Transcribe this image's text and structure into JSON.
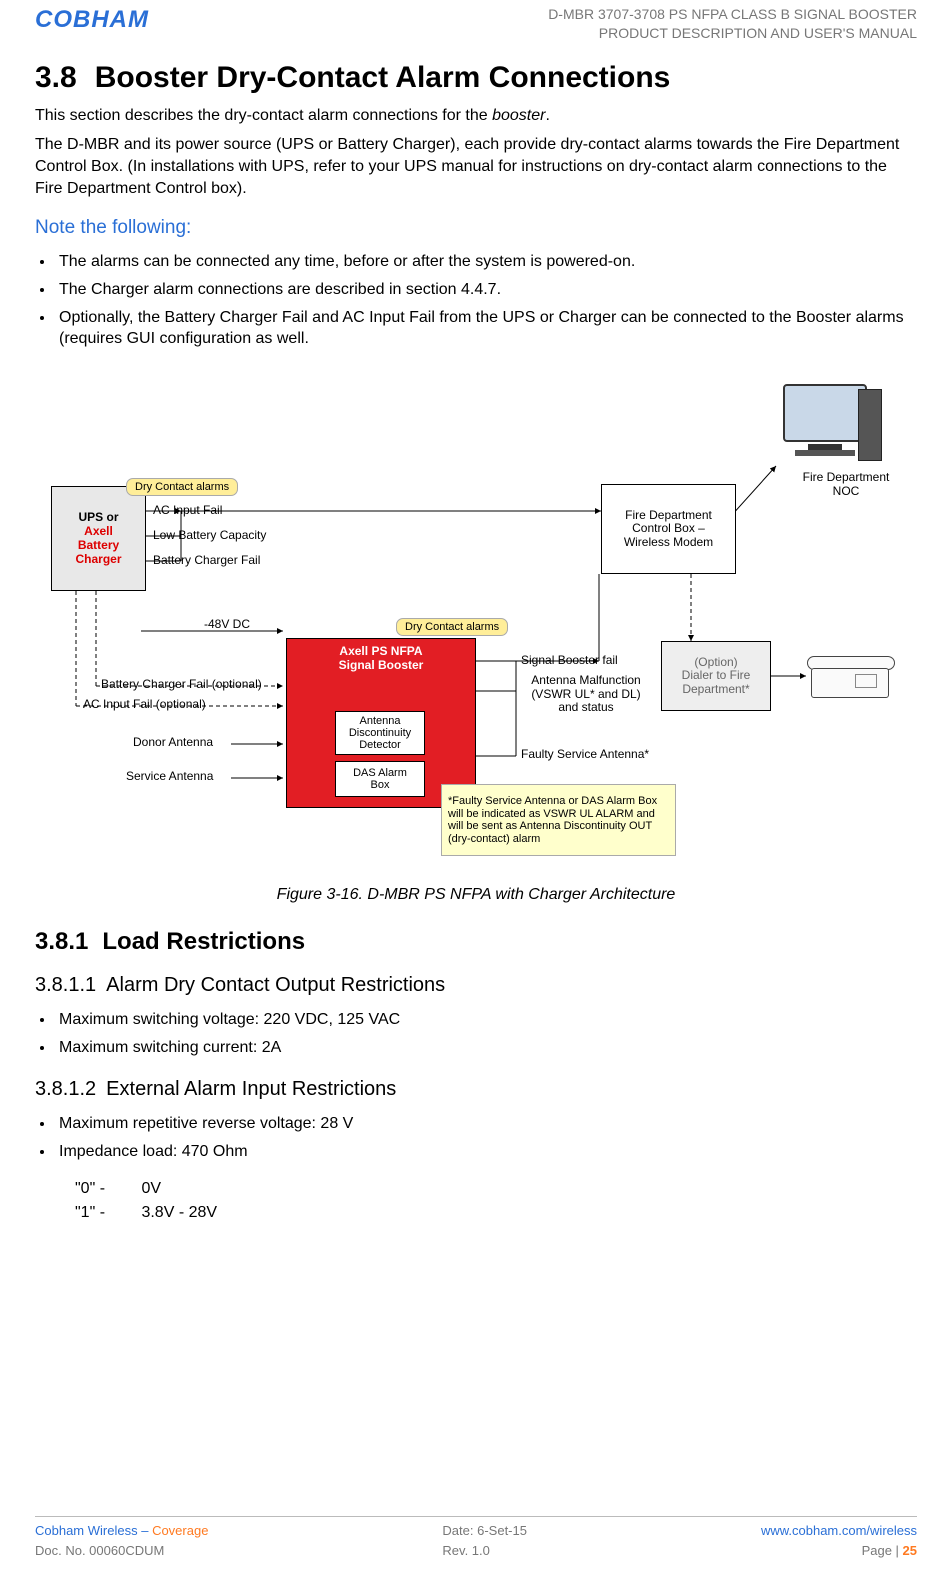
{
  "header": {
    "logo_text": "COBHAM",
    "line1": "D-MBR 3707-3708 PS NFPA CLASS B SIGNAL BOOSTER",
    "line2": "PRODUCT DESCRIPTION AND USER'S MANUAL"
  },
  "section": {
    "number": "3.8",
    "title": "Booster Dry-Contact Alarm Connections",
    "intro1_a": "This section describes the dry-contact alarm connections for the ",
    "intro1_em": "booster",
    "intro1_b": ".",
    "intro2": "The D-MBR and its power source (UPS or Battery Charger), each provide dry-contact alarms towards the Fire Department Control Box. (In installations with UPS, refer to your UPS manual for instructions on dry-contact alarm connections to the Fire Department Control box).",
    "note_title": "Note the following:",
    "bullets": [
      "The alarms can be connected any time, before or after the system is powered-on.",
      "The Charger alarm connections are described in section 4.4.7.",
      "Optionally, the Battery Charger Fail and AC Input Fail from the UPS or Charger can be connected to the Booster alarms (requires GUI configuration as well."
    ]
  },
  "figure": {
    "caption": "Figure 3-16. D-MBR PS NFPA with Charger Architecture",
    "yellow_labels": {
      "dca1": "Dry Contact alarms",
      "dca2": "Dry Contact alarms"
    },
    "ups_box_line1": "UPS or",
    "ups_box_line2": "Axell",
    "ups_box_line3": "Battery Charger",
    "ups_alarms": {
      "a1": "AC Input Fail",
      "a2": "Low Battery Capacity",
      "a3": "Battery Charger Fail"
    },
    "dashed": {
      "d1": "Battery Charger Fail (optional)",
      "d2": "AC Input Fail (optional)"
    },
    "dc_label": "-48V DC",
    "antennas": {
      "donor": "Donor Antenna",
      "service": "Service Antenna"
    },
    "red_box_line1": "Axell PS NFPA",
    "red_box_line2": "Signal Booster",
    "red_inner": {
      "add": "Antenna\nDiscontinuity\nDetector",
      "das": "DAS Alarm\nBox"
    },
    "out_alarms": {
      "o1": "Signal Booster fail",
      "o2": "Antenna Malfunction\n(VSWR UL* and DL)\nand status",
      "o3": "Faulty Service Antenna*"
    },
    "fdc_box": "Fire Department\nControl Box –\nWireless Modem",
    "option_box": "(Option)\nDialer to Fire\nDepartment*",
    "noc_label": "Fire Department\nNOC",
    "note_box": "*Faulty Service Antenna or DAS Alarm Box will be indicated as VSWR UL ALARM and will be sent as Antenna Discontinuity OUT (dry-contact) alarm"
  },
  "sub": {
    "s381_num": "3.8.1",
    "s381_title": "Load Restrictions",
    "s3811_num": "3.8.1.1",
    "s3811_title": "Alarm Dry Contact Output Restrictions",
    "s3811_bullets": [
      "Maximum switching voltage: 220 VDC, 125 VAC",
      "Maximum switching current: 2A"
    ],
    "s3812_num": "3.8.1.2",
    "s3812_title": "External Alarm Input Restrictions",
    "s3812_bullets": [
      "Maximum repetitive reverse voltage: 28 V",
      "Impedance load: 470 Ohm"
    ],
    "levels": [
      {
        "k": "\"0\" -",
        "v": "0V"
      },
      {
        "k": "\"1\" -",
        "v": "3.8V - 28V"
      }
    ]
  },
  "footer": {
    "brand_a": "Cobham Wireless",
    "brand_sep": " – ",
    "brand_b": "Coverage",
    "doc": "Doc. No. 00060CDUM",
    "date": "Date: 6-Set-15",
    "rev": "Rev. 1.0",
    "url": "www.cobham.com/wireless",
    "page_label": "Page | ",
    "page_num": "25"
  }
}
